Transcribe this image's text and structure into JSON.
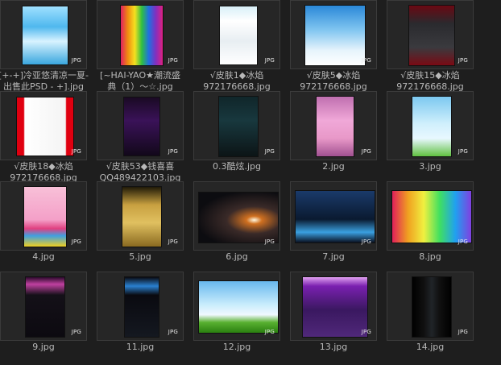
{
  "files": [
    {
      "line1": "[+-+]冷亚悠清凉一夏-",
      "line2": "出售此PSD - +].jpg",
      "badge": "JPG",
      "thumb": "thumb-sky-blue"
    },
    {
      "line1": "[~HAI-YAO★潮流盛",
      "line2": "典（1）～☆.jpg",
      "badge": "JPG",
      "thumb": "thumb-rainbow-dark"
    },
    {
      "line1": "√皮肤1◆冰焰",
      "line2": "972176668.jpg",
      "badge": "JPG",
      "thumb": "thumb-white-blog"
    },
    {
      "line1": "√皮肤5◆冰焰",
      "line2": "972176668.jpg",
      "badge": "JPG",
      "thumb": "thumb-blue-sky"
    },
    {
      "line1": "√皮肤15◆冰焰",
      "line2": "972176668.jpg",
      "badge": "JPG",
      "thumb": "thumb-dark-red"
    },
    {
      "line1": "√皮肤18◆冰焰",
      "line2": "972176668.jpg",
      "badge": "JPG",
      "thumb": "thumb-red-white"
    },
    {
      "line1": "√皮肤53◆钱喜喜",
      "line2": "QQ489422103.jpg",
      "badge": "JPG",
      "thumb": "thumb-dark-purple"
    },
    {
      "line1": "0.3酷炫.jpg",
      "line2": "",
      "badge": "JPG",
      "thumb": "thumb-dark-teal"
    },
    {
      "line1": "2.jpg",
      "line2": "",
      "badge": "JPG",
      "thumb": "thumb-pink"
    },
    {
      "line1": "3.jpg",
      "line2": "",
      "badge": "JPG",
      "thumb": "thumb-light-blue-grass"
    },
    {
      "line1": "4.jpg",
      "line2": "",
      "badge": "JPG",
      "thumb": "thumb-pink-rainbow"
    },
    {
      "line1": "5.jpg",
      "line2": "",
      "badge": "JPG",
      "thumb": "thumb-gold"
    },
    {
      "line1": "6.jpg",
      "line2": "",
      "badge": "JPG",
      "thumb": "thumb-dark-light"
    },
    {
      "line1": "7.jpg",
      "line2": "",
      "badge": "JPG",
      "thumb": "thumb-dark-blue-wave"
    },
    {
      "line1": "8.jpg",
      "line2": "",
      "badge": "JPG",
      "thumb": "thumb-rainbow-glow"
    },
    {
      "line1": "9.jpg",
      "line2": "",
      "badge": "JPG",
      "thumb": "thumb-dark-pink"
    },
    {
      "line1": "11.jpg",
      "line2": "",
      "badge": "JPG",
      "thumb": "thumb-black-blue"
    },
    {
      "line1": "12.jpg",
      "line2": "",
      "badge": "JPG",
      "thumb": "thumb-sky-grass"
    },
    {
      "line1": "13.jpg",
      "line2": "",
      "badge": "JPG",
      "thumb": "thumb-violet"
    },
    {
      "line1": "14.jpg",
      "line2": "",
      "badge": "JPG",
      "thumb": "thumb-black-strip"
    }
  ]
}
